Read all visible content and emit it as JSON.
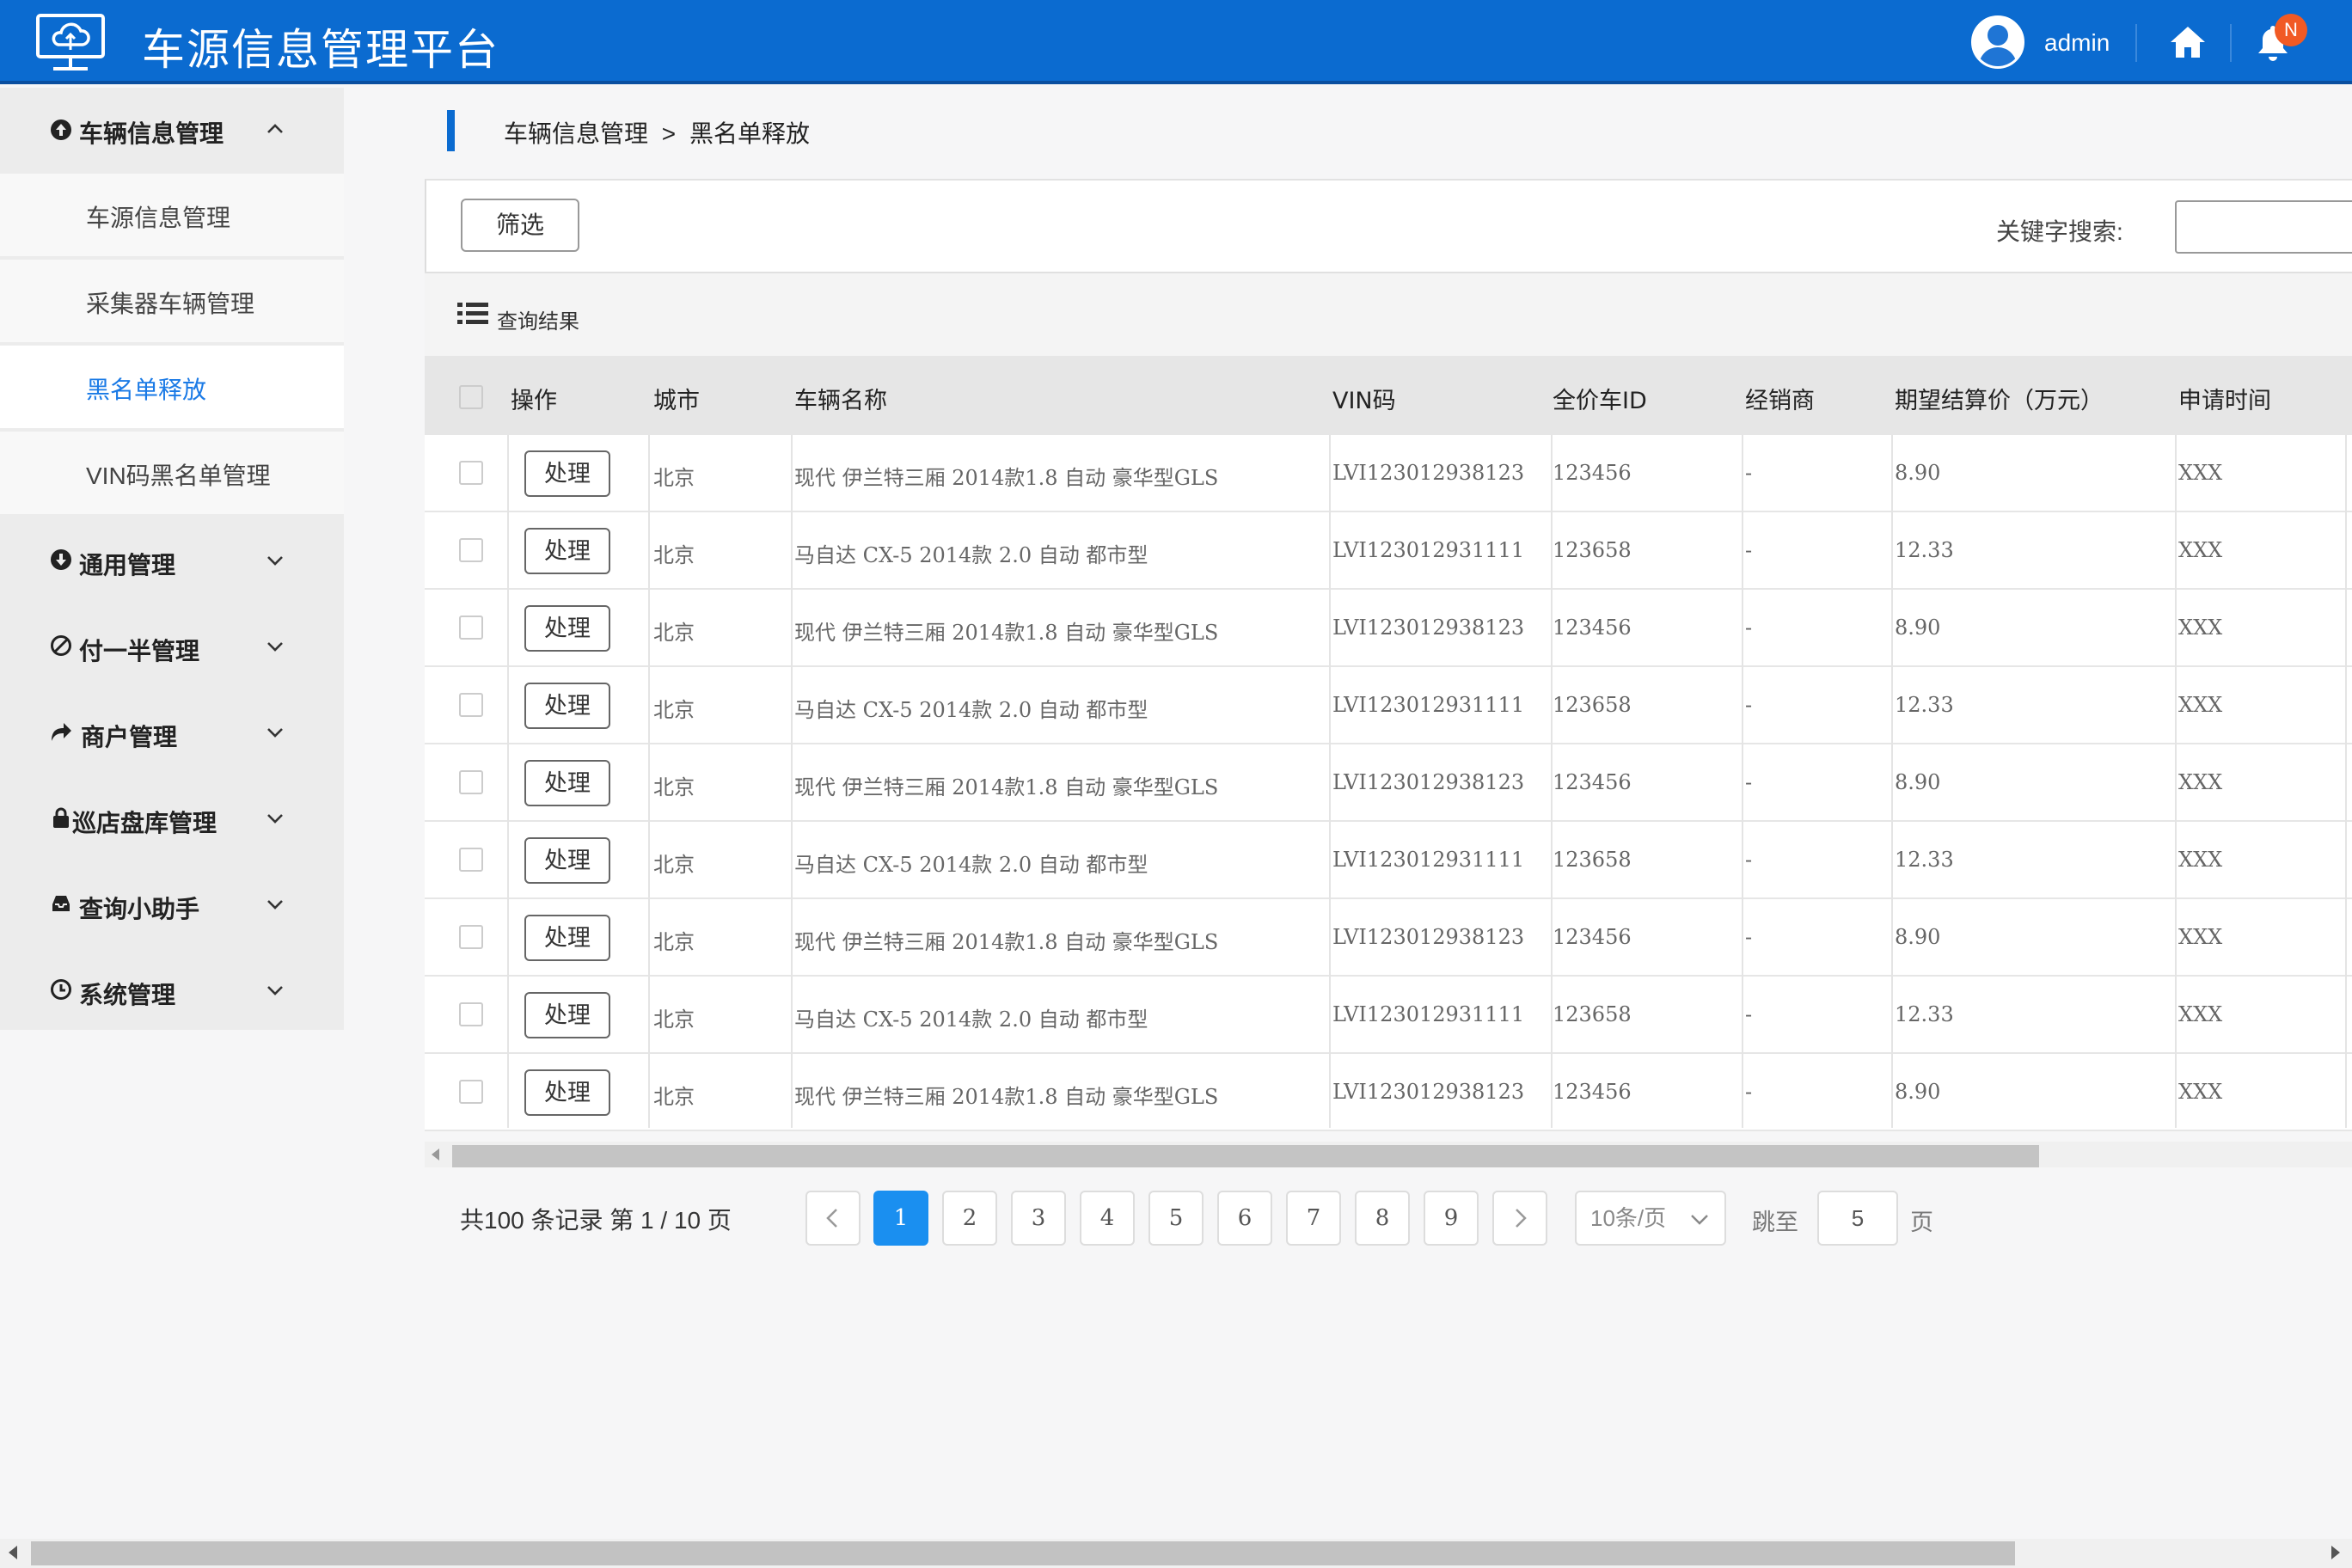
{
  "header": {
    "title": "车源信息管理平台",
    "username": "admin",
    "notification_badge": "N",
    "accent_color": "#0b6bd0",
    "badge_color": "#f15a24"
  },
  "sidebar": {
    "top_menu": {
      "label": "车辆信息管理",
      "icon": "circle-arrow-up-icon",
      "expanded": true
    },
    "sub_items": [
      {
        "label": "车源信息管理",
        "active": false
      },
      {
        "label": "采集器车辆管理",
        "active": false
      },
      {
        "label": "黑名单释放",
        "active": true
      },
      {
        "label": "VIN码黑名单管理",
        "active": false
      }
    ],
    "menus": [
      {
        "label": "通用管理",
        "icon": "circle-arrow-down-icon"
      },
      {
        "label": "付一半管理",
        "icon": "ban-icon"
      },
      {
        "label": "商户管理",
        "icon": "share-arrow-icon"
      },
      {
        "label": "巡店盘库管理",
        "icon": "lock-icon"
      },
      {
        "label": "查询小助手",
        "icon": "inbox-icon"
      },
      {
        "label": "系统管理",
        "icon": "clock-icon"
      }
    ]
  },
  "breadcrumb": {
    "parent": "车辆信息管理",
    "separator": ">",
    "current": "黑名单释放"
  },
  "toolbar": {
    "filter_label": "筛选",
    "search_label": "关键字搜索:",
    "search_value": ""
  },
  "results": {
    "label": "查询结果"
  },
  "table": {
    "headers": [
      "操作",
      "城市",
      "车辆名称",
      "VIN码",
      "全价车ID",
      "经销商",
      "期望结算价（万元）",
      "申请时间"
    ],
    "action_label": "处理",
    "rows": [
      [
        "北京",
        "现代 伊兰特三厢 2014款1.8 自动 豪华型GLS",
        "LVI123012938123",
        "123456",
        "-",
        "8.90",
        "XXX"
      ],
      [
        "北京",
        "马自达 CX-5 2014款 2.0 自动 都市型",
        "LVI123012931111",
        "123658",
        "-",
        "12.33",
        "XXX"
      ],
      [
        "北京",
        "现代 伊兰特三厢 2014款1.8 自动 豪华型GLS",
        "LVI123012938123",
        "123456",
        "-",
        "8.90",
        "XXX"
      ],
      [
        "北京",
        "马自达 CX-5 2014款 2.0 自动 都市型",
        "LVI123012931111",
        "123658",
        "-",
        "12.33",
        "XXX"
      ],
      [
        "北京",
        "现代 伊兰特三厢 2014款1.8 自动 豪华型GLS",
        "LVI123012938123",
        "123456",
        "-",
        "8.90",
        "XXX"
      ],
      [
        "北京",
        "马自达 CX-5 2014款 2.0 自动 都市型",
        "LVI123012931111",
        "123658",
        "-",
        "12.33",
        "XXX"
      ],
      [
        "北京",
        "现代 伊兰特三厢 2014款1.8 自动 豪华型GLS",
        "LVI123012938123",
        "123456",
        "-",
        "8.90",
        "XXX"
      ],
      [
        "北京",
        "马自达 CX-5 2014款 2.0 自动 都市型",
        "LVI123012931111",
        "123658",
        "-",
        "12.33",
        "XXX"
      ],
      [
        "北京",
        "现代 伊兰特三厢 2014款1.8 自动 豪华型GLS",
        "LVI123012938123",
        "123456",
        "-",
        "8.90",
        "XXX"
      ]
    ]
  },
  "pagination": {
    "summary": "共100 条记录 第 1 / 10 页",
    "pages": [
      "1",
      "2",
      "3",
      "4",
      "5",
      "6",
      "7",
      "8",
      "9"
    ],
    "current_page": "1",
    "page_size": "10条/页",
    "jump_label": "跳至",
    "jump_value": "5",
    "jump_suffix": "页"
  }
}
